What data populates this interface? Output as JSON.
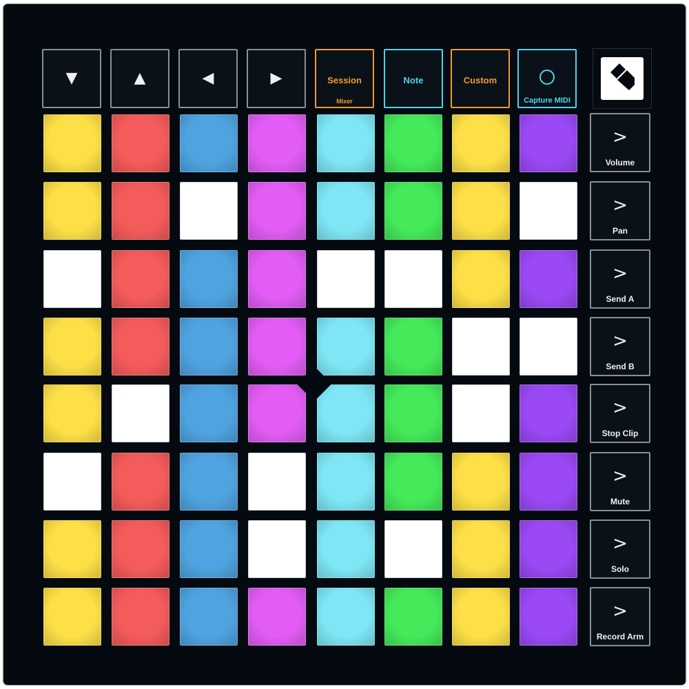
{
  "colors": {
    "yellow": "#fde047",
    "red": "#f45b5b",
    "blue": "#4fa3e0",
    "magenta": "#e25cf5",
    "cyan": "#7ee6f5",
    "green": "#44ea5a",
    "purple": "#9a49f5",
    "white": "#ffffff",
    "orange_accent": "#f29a2e",
    "cyan_accent": "#4fd3ee"
  },
  "nav_buttons": [
    {
      "name": "down-arrow-button",
      "icon": "▼"
    },
    {
      "name": "up-arrow-button",
      "icon": "▲"
    },
    {
      "name": "left-arrow-button",
      "icon": "◀"
    },
    {
      "name": "right-arrow-button",
      "icon": "▶"
    }
  ],
  "mode_buttons": {
    "session": {
      "label": "Session",
      "sub": "Mixer"
    },
    "note": {
      "label": "Note"
    },
    "custom": {
      "label": "Custom"
    },
    "capture": {
      "label": "Capture MIDI"
    }
  },
  "side_buttons": [
    {
      "label": "Volume",
      "icon": ">"
    },
    {
      "label": "Pan",
      "icon": ">"
    },
    {
      "label": "Send A",
      "icon": ">"
    },
    {
      "label": "Send B",
      "icon": ">"
    },
    {
      "label": "Stop Clip",
      "icon": ">"
    },
    {
      "label": "Mute",
      "icon": ">"
    },
    {
      "label": "Solo",
      "icon": ">"
    },
    {
      "label": "Record Arm",
      "icon": ">"
    }
  ],
  "pad_grid": [
    [
      "yellow",
      "red",
      "blue",
      "magenta",
      "cyan",
      "green",
      "yellow",
      "purple"
    ],
    [
      "yellow",
      "red",
      "white",
      "magenta",
      "cyan",
      "green",
      "yellow",
      "white"
    ],
    [
      "white",
      "red",
      "blue",
      "magenta",
      "white",
      "white",
      "yellow",
      "purple"
    ],
    [
      "yellow",
      "red",
      "blue",
      "magenta",
      "cyan",
      "green",
      "white",
      "white"
    ],
    [
      "yellow",
      "white",
      "blue",
      "magenta",
      "cyan",
      "green",
      "white",
      "purple"
    ],
    [
      "white",
      "red",
      "blue",
      "white",
      "cyan",
      "green",
      "yellow",
      "purple"
    ],
    [
      "yellow",
      "red",
      "blue",
      "white",
      "cyan",
      "white",
      "yellow",
      "purple"
    ],
    [
      "yellow",
      "red",
      "blue",
      "magenta",
      "cyan",
      "green",
      "yellow",
      "purple"
    ]
  ]
}
